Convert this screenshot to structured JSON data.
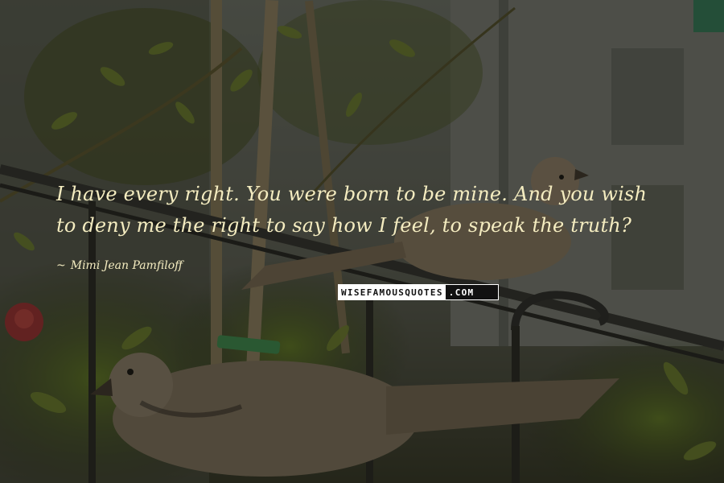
{
  "quote": {
    "line1": "I have every right. You were born to be mine. And you wish",
    "line2": "to deny me the right to say how I feel, to speak the truth?"
  },
  "author": {
    "dash": "~",
    "name": "Mimi Jean Pamfiloff"
  },
  "watermark": {
    "part1": "WISEFAMOUSQUOTES",
    "part2": ".COM"
  },
  "colors": {
    "quote_text": "#f4ecc0",
    "background_foliage": "#4c5a2a",
    "dove": "#8c7c66"
  }
}
